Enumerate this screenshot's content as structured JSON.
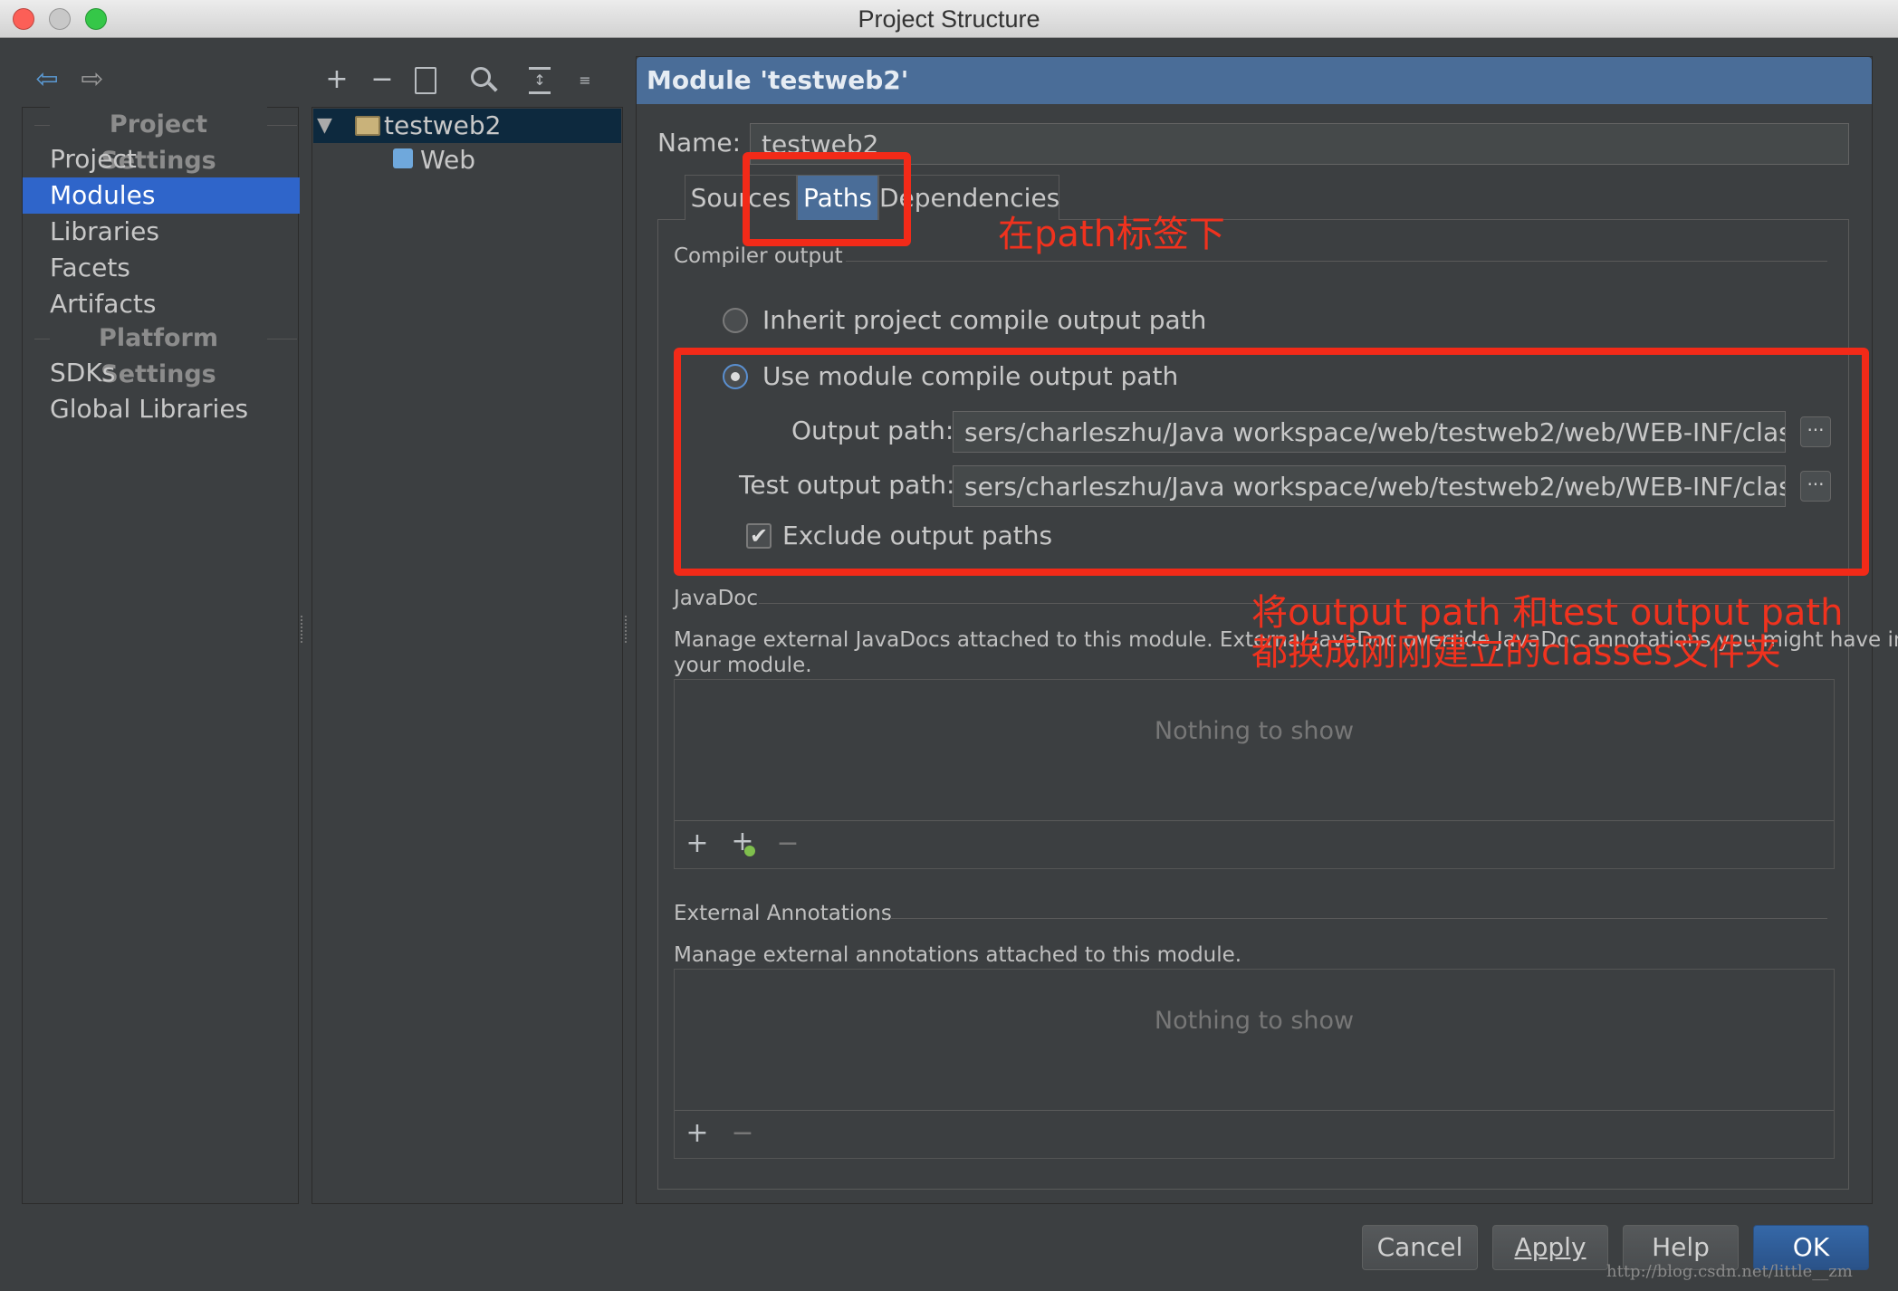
{
  "window": {
    "title": "Project Structure"
  },
  "toolbar_left": {
    "back_icon": "arrow-left-icon",
    "forward_icon": "arrow-right-icon"
  },
  "sidebar": {
    "project_settings_header": "Project Settings",
    "platform_settings_header": "Platform Settings",
    "items": [
      {
        "label": "Project"
      },
      {
        "label": "Modules",
        "selected": true
      },
      {
        "label": "Libraries"
      },
      {
        "label": "Facets"
      },
      {
        "label": "Artifacts"
      },
      {
        "label": "SDKs"
      },
      {
        "label": "Global Libraries"
      }
    ]
  },
  "tree_toolbar": {
    "add": "+",
    "remove": "−"
  },
  "tree": {
    "root": {
      "label": "testweb2",
      "expanded": true
    },
    "children": [
      {
        "label": "Web"
      }
    ]
  },
  "module": {
    "header": "Module 'testweb2'",
    "name_label": "Name:",
    "name_value": "testweb2",
    "tabs": [
      {
        "label": "Sources"
      },
      {
        "label": "Paths",
        "selected": true
      },
      {
        "label": "Dependencies"
      }
    ],
    "compiler_output": {
      "section_title": "Compiler output",
      "inherit_label": "Inherit project compile output path",
      "use_module_label": "Use module compile output path",
      "selected_option": "use_module",
      "output_path_label": "Output path:",
      "output_path_value": "sers/charleszhu/Java workspace/web/testweb2/web/WEB-INF/classes",
      "test_output_path_label": "Test output path:",
      "test_output_path_value": "sers/charleszhu/Java workspace/web/testweb2/web/WEB-INF/classes",
      "browse_label": "···",
      "exclude_label": "Exclude output paths",
      "exclude_checked": true
    },
    "javadoc": {
      "section_title": "JavaDoc",
      "description_line1": "Manage external JavaDocs attached to this module. External JavaDoc override JavaDoc annotations you might have in",
      "description_line2": "your module.",
      "empty_text": "Nothing to show",
      "add": "+",
      "add_url": "+",
      "remove": "−"
    },
    "external_annotations": {
      "section_title": "External Annotations",
      "description": "Manage external annotations attached to this module.",
      "empty_text": "Nothing to show",
      "add": "+",
      "remove": "−"
    }
  },
  "buttons": {
    "cancel": "Cancel",
    "apply": "Apply",
    "help": "Help",
    "ok": "OK"
  },
  "annotations": {
    "tab_note": "在path标签下",
    "path_note_line1": "将output path 和test output path",
    "path_note_line2": "都换成刚刚建立的classes文件夹"
  },
  "watermark": "http://blog.csdn.net/little__zm",
  "colors": {
    "selection": "#2f65ca",
    "header": "#4a6d98",
    "annotation_red": "#f22a18",
    "ok_button": "#2e5a91"
  }
}
